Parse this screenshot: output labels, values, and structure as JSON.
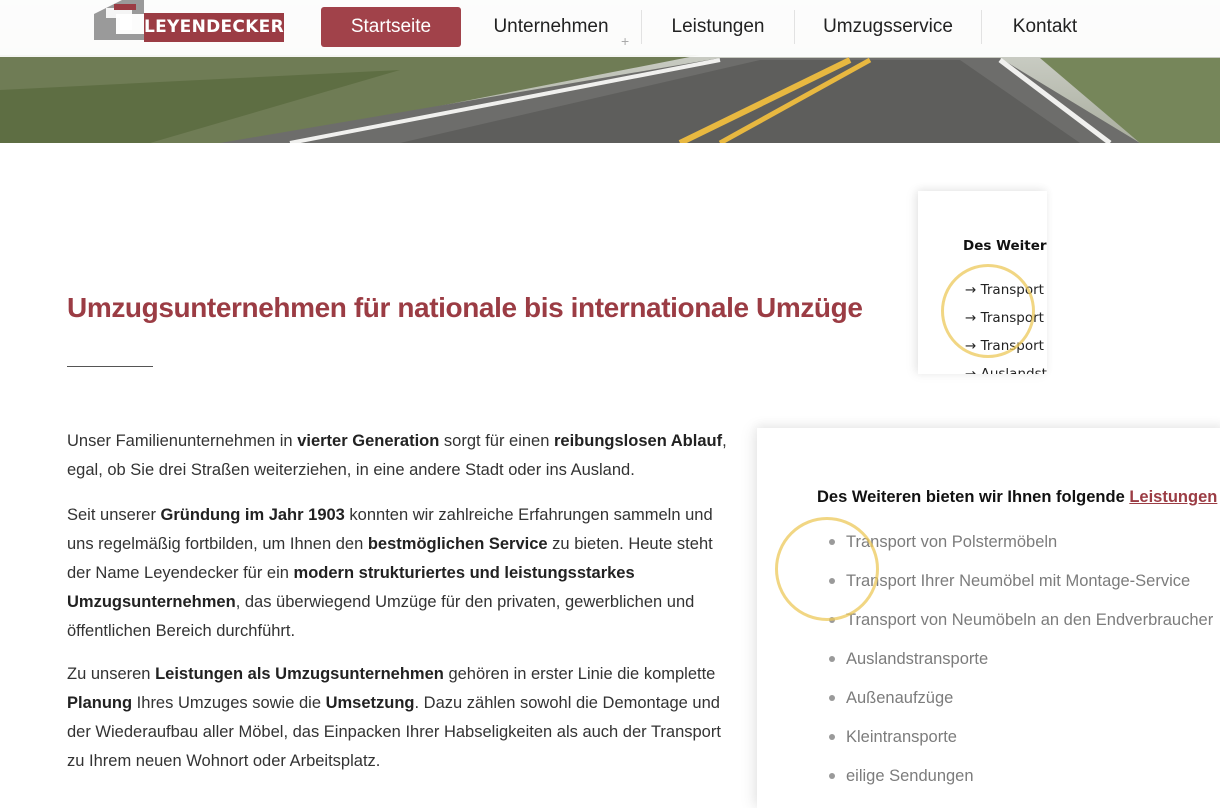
{
  "brand": {
    "name": "LEYENDECKER",
    "color": "#9b3c44"
  },
  "nav": {
    "items": [
      {
        "label": "Startseite",
        "active": true
      },
      {
        "label": "Unternehmen",
        "active": false
      },
      {
        "label": "Leistungen",
        "active": false
      },
      {
        "label": "Umzugsservice",
        "active": false
      },
      {
        "label": "Kontakt",
        "active": false
      }
    ],
    "submenu_indicator": "+"
  },
  "main": {
    "headline": "Umzugsunternehmen für nationale bis internationale Umzüge",
    "paragraphs": [
      [
        {
          "t": "Unser Familienunternehmen in ",
          "b": false
        },
        {
          "t": "vierter Generation",
          "b": true
        },
        {
          "t": " sorgt für einen ",
          "b": false
        },
        {
          "t": "reibungslosen Ablauf",
          "b": true
        },
        {
          "t": ", egal, ob Sie drei Straßen weiterziehen, in eine andere Stadt oder ins Ausland.",
          "b": false
        }
      ],
      [
        {
          "t": "Seit unserer ",
          "b": false
        },
        {
          "t": "Gründung im Jahr 1903",
          "b": true
        },
        {
          "t": " konnten wir zahlreiche Erfahrungen sammeln und uns regelmäßig fortbilden, um Ihnen den ",
          "b": false
        },
        {
          "t": "bestmöglichen Service",
          "b": true
        },
        {
          "t": " zu bieten. Heute steht der Name Leyendecker für ein ",
          "b": false
        },
        {
          "t": "modern strukturiertes und leistungsstarkes Umzugsunternehmen",
          "b": true
        },
        {
          "t": ", das überwiegend Umzüge für den privaten, gewerblichen und öffentlichen Bereich durchführt.",
          "b": false
        }
      ],
      [
        {
          "t": "Zu unseren ",
          "b": false
        },
        {
          "t": "Leistungen als Umzugsunternehmen",
          "b": true
        },
        {
          "t": " gehören in erster Linie die komplette ",
          "b": false
        },
        {
          "t": "Planung",
          "b": true
        },
        {
          "t": " Ihres Umzuges sowie die ",
          "b": false
        },
        {
          "t": "Umsetzung",
          "b": true
        },
        {
          "t": ". Dazu zählen sowohl die Demontage und der Wiederaufbau aller Möbel, das Einpacken Ihrer Habseligkeiten als auch der Transport zu Ihrem neuen Wohnort oder Arbeitsplatz.",
          "b": false
        }
      ]
    ]
  },
  "sidebar_small": {
    "title": "Des Weitere",
    "items": [
      "→ Transport",
      "→ Transport",
      "→ Transport",
      "→ Auslandst"
    ]
  },
  "sidebar_big": {
    "title_prefix": "Des Weiteren bieten wir Ihnen folgende ",
    "title_link": "Leistungen",
    "items": [
      "Transport von Polstermöbeln",
      "Transport Ihrer Neumöbel mit Montage-Service",
      "Transport von Neumöbeln an den Endverbraucher",
      "Auslandstransporte",
      "Außenaufzüge",
      "Kleintransporte",
      "eilige Sendungen"
    ]
  }
}
